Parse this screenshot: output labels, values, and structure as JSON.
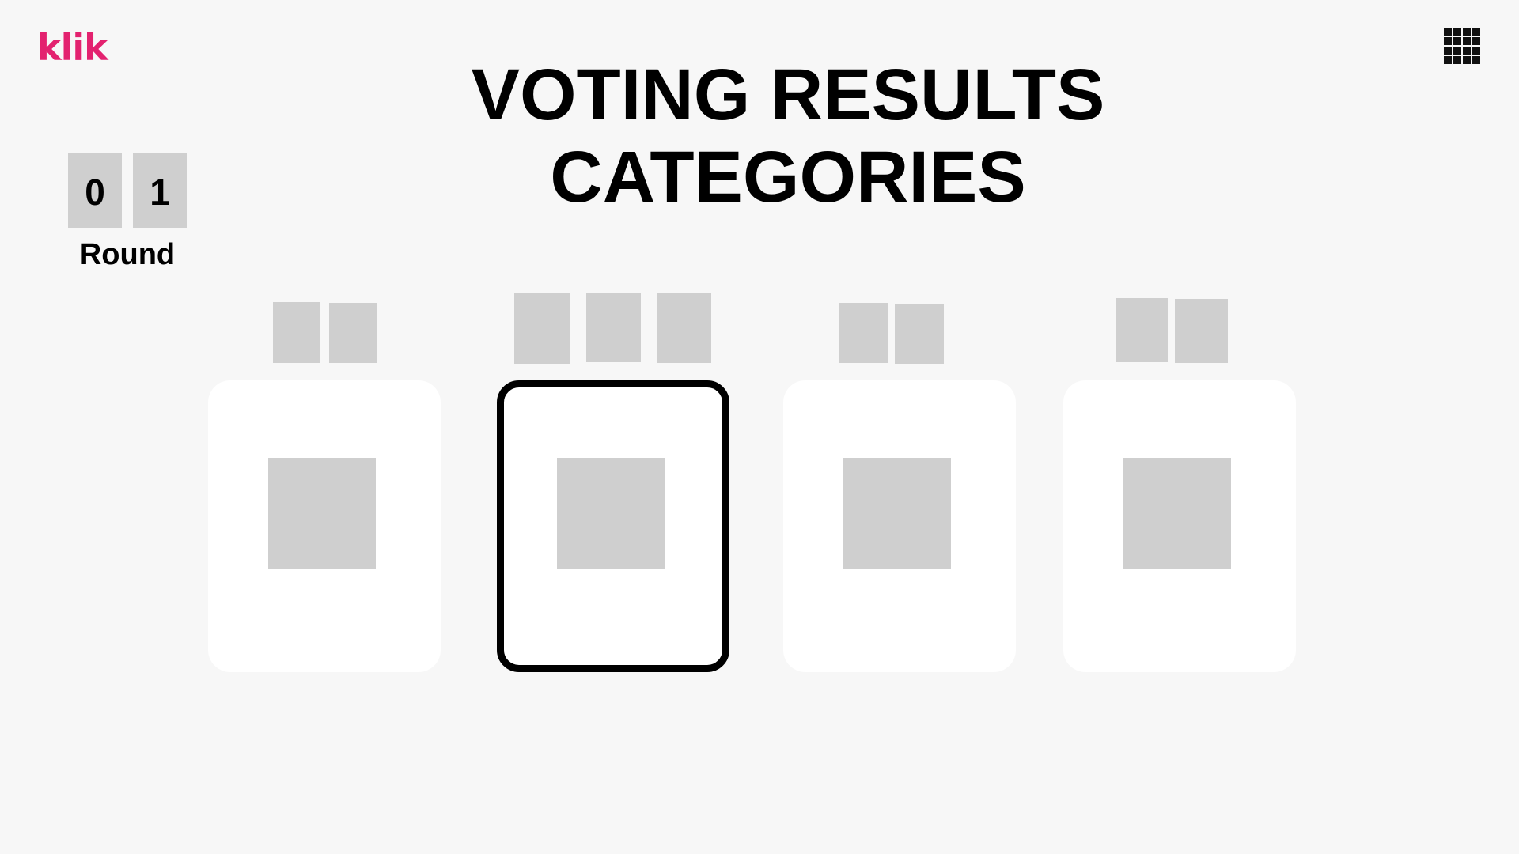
{
  "header": {
    "logo": "klik",
    "menu_icon": "grid-menu-icon"
  },
  "title": {
    "line1": "VOTING RESULTS",
    "line2": "CATEGORIES"
  },
  "round": {
    "digits": [
      "0",
      "1"
    ],
    "label": "Round"
  },
  "cards": {
    "count": 4,
    "selected_index": 1
  },
  "colors": {
    "brand": "#e3226f",
    "background": "#f7f7f7",
    "placeholder": "#cfcfcf",
    "card": "#ffffff",
    "selected_border": "#000000"
  }
}
